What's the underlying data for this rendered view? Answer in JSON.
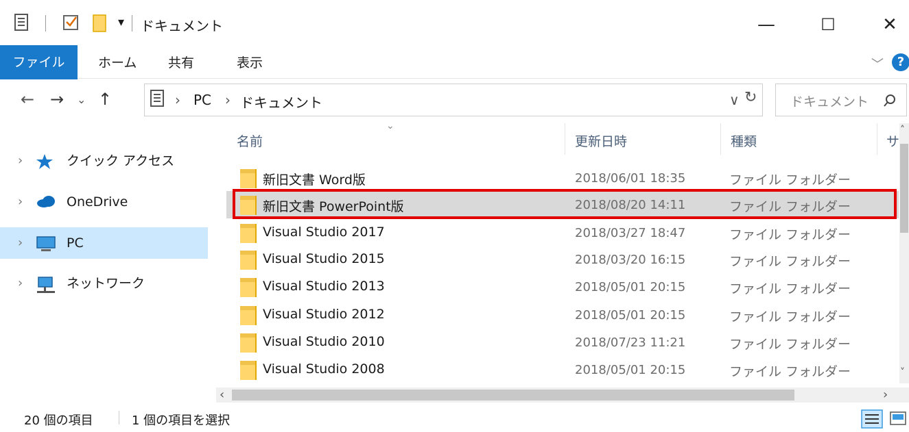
{
  "window": {
    "title": "ドキュメント",
    "min": "—",
    "max": "☐",
    "close": "✕"
  },
  "ribbon": {
    "tabs": [
      "ファイル",
      "ホーム",
      "共有",
      "表示"
    ],
    "expand": "﹀",
    "help": "?"
  },
  "address": {
    "crumbs": [
      "PC",
      "ドキュメント"
    ],
    "sep": "›",
    "dropdown": "∨",
    "refresh": "↻",
    "search_placeholder": "ドキュメント"
  },
  "nav_pane": {
    "items": [
      {
        "label": "クイック アクセス"
      },
      {
        "label": "OneDrive"
      },
      {
        "label": "PC"
      },
      {
        "label": "ネットワーク"
      }
    ]
  },
  "columns": {
    "name": "名前",
    "date": "更新日時",
    "type": "種類",
    "size": "サ"
  },
  "files": [
    {
      "name": "新旧文書 Word版",
      "date": "2018/06/01 18:35",
      "type": "ファイル フォルダー"
    },
    {
      "name": "新旧文書 PowerPoint版",
      "date": "2018/08/20 14:11",
      "type": "ファイル フォルダー"
    },
    {
      "name": "Visual Studio 2017",
      "date": "2018/03/27 18:47",
      "type": "ファイル フォルダー"
    },
    {
      "name": "Visual Studio 2015",
      "date": "2018/03/20 16:15",
      "type": "ファイル フォルダー"
    },
    {
      "name": "Visual Studio 2013",
      "date": "2018/05/01 20:15",
      "type": "ファイル フォルダー"
    },
    {
      "name": "Visual Studio 2012",
      "date": "2018/05/01 20:15",
      "type": "ファイル フォルダー"
    },
    {
      "name": "Visual Studio 2010",
      "date": "2018/07/23 11:21",
      "type": "ファイル フォルダー"
    },
    {
      "name": "Visual Studio 2008",
      "date": "2018/05/01 20:15",
      "type": "ファイル フォルダー"
    }
  ],
  "status": {
    "count": "20 個の項目",
    "selected": "1 個の項目を選択"
  },
  "colors": {
    "accent": "#1979ca",
    "highlight_border": "#e00000",
    "selected_nav": "#cce8ff"
  }
}
